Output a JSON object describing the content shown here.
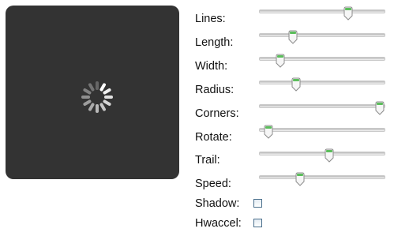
{
  "spinner": {
    "lines": 12,
    "color": "#ffffff"
  },
  "controls": {
    "lines": {
      "label": "Lines:",
      "value": 0.72
    },
    "length": {
      "label": "Length:",
      "value": 0.25
    },
    "width": {
      "label": "Width:",
      "value": 0.14
    },
    "radius": {
      "label": "Radius:",
      "value": 0.28
    },
    "corners": {
      "label": "Corners:",
      "value": 0.99
    },
    "rotate": {
      "label": "Rotate:",
      "value": 0.04
    },
    "trail": {
      "label": "Trail:",
      "value": 0.56
    },
    "speed": {
      "label": "Speed:",
      "value": 0.31
    },
    "shadow": {
      "label": "Shadow:",
      "checked": false
    },
    "hwaccel": {
      "label": "Hwaccel:",
      "checked": false
    }
  },
  "colors": {
    "thumb_accent": "#5bbd5b",
    "panel_bg": "#333333"
  }
}
